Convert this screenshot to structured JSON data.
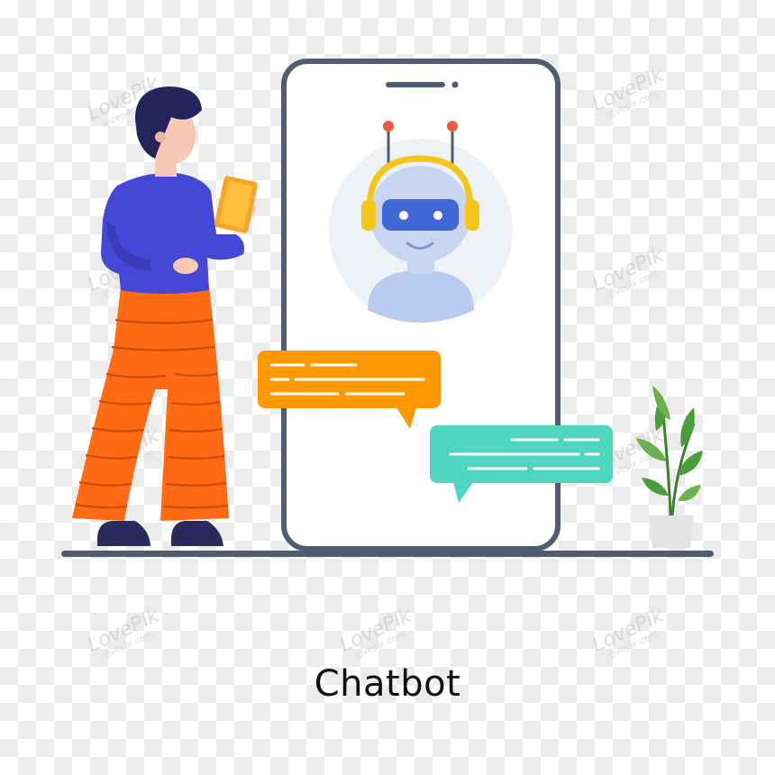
{
  "caption": "Chatbot",
  "watermark": {
    "brand": "LovePik",
    "sub": "lovepik.com"
  },
  "colors": {
    "phone_frame": "#4f5d73",
    "robot_face": "#3f67d6",
    "headphone": "#f5c518",
    "antenna_tip": "#f05a3c",
    "bubble_orange": "#ff9800",
    "bubble_teal": "#4fd6c2",
    "shirt": "#4547d6",
    "pants": "#ff6a13",
    "plant": "#4a9c3c"
  },
  "icons": [
    "robot-avatar-icon",
    "potted-plant-icon"
  ]
}
